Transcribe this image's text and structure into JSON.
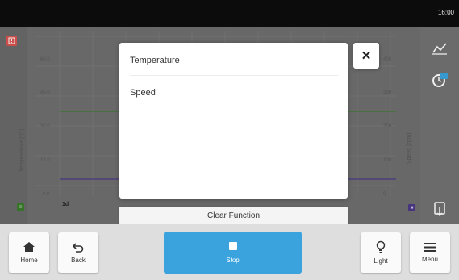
{
  "status_bar": {
    "time": "16:00"
  },
  "chart": {
    "y_left_ticks": [
      "60.0",
      "45.0",
      "30.0",
      "15.0",
      "0.0"
    ],
    "y_right_ticks": [
      "400",
      "300",
      "200",
      "100",
      "0"
    ],
    "y_left_label": "Temperature [°C]",
    "y_right_label": "Speed [rpm]",
    "x_first_label": "1d",
    "series_colors": {
      "temperature": "#3a7d2c",
      "speed": "#4c3a86"
    }
  },
  "dialog": {
    "options": [
      "Temperature",
      "Speed"
    ],
    "clear_label": "Clear Function"
  },
  "bottom_nav": {
    "home": "Home",
    "back": "Back",
    "stop": "Stop",
    "light": "Light",
    "menu": "Menu"
  },
  "colors": {
    "accent": "#3aa3dd",
    "alert": "#e24b3b"
  }
}
